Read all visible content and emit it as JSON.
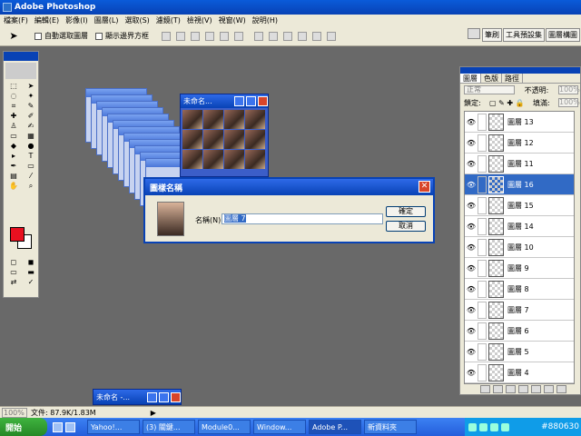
{
  "app": {
    "title": "Adobe Photoshop"
  },
  "menu": [
    "檔案(F)",
    "編輯(E)",
    "影像(I)",
    "圖層(L)",
    "選取(S)",
    "濾鏡(T)",
    "檢視(V)",
    "視窗(W)",
    "說明(H)"
  ],
  "options": {
    "auto_select": "自動選取圖層",
    "show_bounds": "顯示邊界方框"
  },
  "palette_well": [
    "筆刷",
    "工具預設集",
    "圖層構圖"
  ],
  "doc_window": {
    "title": "未命名..."
  },
  "minimized_window": {
    "title": "未命名 -..."
  },
  "dialog": {
    "title": "圖樣名稱",
    "name_label": "名稱(N):",
    "name_value": "圖層 7",
    "ok": "確定",
    "cancel": "取消"
  },
  "layers_panel": {
    "tabs": [
      "圖層",
      "色版",
      "路徑"
    ],
    "blend_mode": "正常",
    "opacity_label": "不透明:",
    "opacity_value": "100%",
    "lock_label": "鎖定:",
    "fill_label": "填滿:",
    "fill_value": "100%",
    "layers": [
      {
        "name": "圖層 13",
        "selected": false
      },
      {
        "name": "圖層 12",
        "selected": false
      },
      {
        "name": "圖層 11",
        "selected": false
      },
      {
        "name": "圖層 16",
        "selected": true
      },
      {
        "name": "圖層 15",
        "selected": false
      },
      {
        "name": "圖層 14",
        "selected": false
      },
      {
        "name": "圖層 10",
        "selected": false
      },
      {
        "name": "圖層 9",
        "selected": false
      },
      {
        "name": "圖層 8",
        "selected": false
      },
      {
        "name": "圖層 7",
        "selected": false
      },
      {
        "name": "圖層 6",
        "selected": false
      },
      {
        "name": "圖層 5",
        "selected": false
      },
      {
        "name": "圖層 4",
        "selected": false
      }
    ]
  },
  "status": {
    "zoom": "100%",
    "doc_size": "文件: 87.9K/1.83M"
  },
  "taskbar": {
    "start": "開始",
    "tasks": [
      "Yahoo!...",
      "(3) 關鍵...",
      "Module0...",
      "Window...",
      "Adobe P...",
      "新資料夾"
    ],
    "active_task": "Adobe P...",
    "tray_tag": "#880630"
  },
  "colors": {
    "foreground": "#e81020",
    "background": "#ffffff",
    "accent": "#0842b5",
    "selection": "#316ac5"
  }
}
